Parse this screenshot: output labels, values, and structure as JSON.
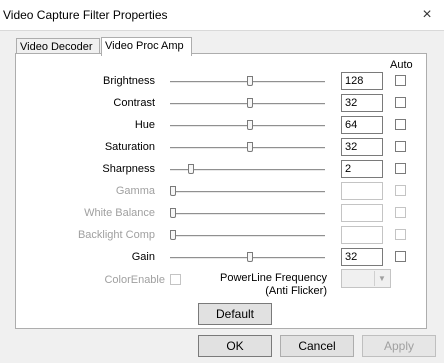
{
  "window": {
    "title": "Video Capture Filter Properties",
    "close_glyph": "×"
  },
  "tabs": [
    {
      "label": "Video Decoder"
    },
    {
      "label": "Video Proc Amp"
    }
  ],
  "auto_header": "Auto",
  "rows": [
    {
      "label": "Brightness",
      "value": "128",
      "enabled": true,
      "slider_level": 0.52
    },
    {
      "label": "Contrast",
      "value": "32",
      "enabled": true,
      "slider_level": 0.52
    },
    {
      "label": "Hue",
      "value": "64",
      "enabled": true,
      "slider_level": 0.52
    },
    {
      "label": "Saturation",
      "value": "32",
      "enabled": true,
      "slider_level": 0.52
    },
    {
      "label": "Sharpness",
      "value": "2",
      "enabled": true,
      "slider_level": 0.12
    },
    {
      "label": "Gamma",
      "value": "",
      "enabled": false,
      "slider_level": 0.0
    },
    {
      "label": "White Balance",
      "value": "",
      "enabled": false,
      "slider_level": 0.0
    },
    {
      "label": "Backlight Comp",
      "value": "",
      "enabled": false,
      "slider_level": 0.0
    },
    {
      "label": "Gain",
      "value": "32",
      "enabled": true,
      "slider_level": 0.52
    }
  ],
  "color_enable": {
    "label": "ColorEnable"
  },
  "powerline": {
    "label_line1": "PowerLine Frequency",
    "label_line2": "(Anti Flicker)",
    "value": ""
  },
  "buttons": {
    "default": "Default",
    "ok": "OK",
    "cancel": "Cancel",
    "apply": "Apply"
  },
  "icons": {
    "close": "close-icon",
    "dropdown": "chevron-down-icon"
  }
}
